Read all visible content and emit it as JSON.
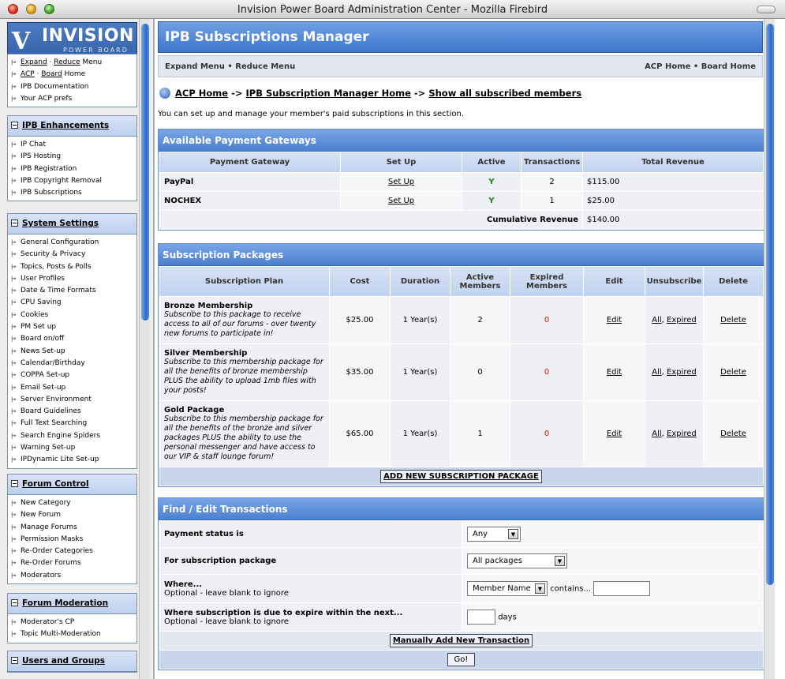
{
  "window": {
    "title": "Invision Power Board Administration Center - Mozilla Firebird"
  },
  "logo": {
    "word": "INVISION",
    "sub": "POWER BOARD"
  },
  "top_links": {
    "expand": "Expand",
    "reduce": "Reduce",
    "menu": "Menu",
    "acp": "ACP",
    "board": "Board",
    "home": "Home",
    "doc": "IPB Documentation",
    "prefs": "Your ACP prefs"
  },
  "sidebar": [
    {
      "title": "IPB Enhancements",
      "items": [
        "IP Chat",
        "IPS Hosting",
        "IPB Registration",
        "IPB Copyright Removal",
        "IPB Subscriptions"
      ]
    },
    {
      "title": "System Settings",
      "items": [
        "General Configuration",
        "Security & Privacy",
        "Topics, Posts & Polls",
        "User Profiles",
        "Date & Time Formats",
        "CPU Saving",
        "Cookies",
        "PM Set up",
        "Board on/off",
        "News Set-up",
        "Calendar/Birthday",
        "COPPA Set-up",
        "Email Set-up",
        "Server Environment",
        "Board Guidelines",
        "Full Text Searching",
        "Search Engine Spiders",
        "Warning Set-up",
        "IPDynamic Lite Set-up"
      ]
    },
    {
      "title": "Forum Control",
      "items": [
        "New Category",
        "New Forum",
        "Manage Forums",
        "Permission Masks",
        "Re-Order Categories",
        "Re-Order Forums",
        "Moderators"
      ]
    },
    {
      "title": "Forum Moderation",
      "items": [
        "Moderator's CP",
        "Topic Multi-Moderation"
      ]
    },
    {
      "title": "Users and Groups",
      "items": []
    }
  ],
  "main": {
    "banner": "IPB Subscriptions Manager",
    "menu_left": "Expand Menu • Reduce Menu",
    "menu_right": "ACP Home • Board Home",
    "crumb1": "ACP Home",
    "sep1": " -> ",
    "crumb2": "IPB Subscription Manager Home",
    "sep2": " -> ",
    "crumb3": "Show all subscribed members",
    "intro": "You can set up and manage your member's paid subscriptions in this section."
  },
  "gateways": {
    "title": "Available Payment Gateways",
    "headers": [
      "Payment Gateway",
      "Set Up",
      "Active",
      "Transactions",
      "Total Revenue"
    ],
    "rows": [
      {
        "name": "PayPal",
        "setup": "Set Up",
        "active": "Y",
        "transactions": "2",
        "revenue": "$115.00"
      },
      {
        "name": "NOCHEX",
        "setup": "Set Up",
        "active": "Y",
        "transactions": "1",
        "revenue": "$25.00"
      }
    ],
    "cum_label": "Cumulative Revenue",
    "cum_value": "$140.00"
  },
  "packages": {
    "title": "Subscription Packages",
    "headers": [
      "Subscription Plan",
      "Cost",
      "Duration",
      "Active Members",
      "Expired Members",
      "Edit",
      "Unsubscribe",
      "Delete"
    ],
    "rows": [
      {
        "name": "Bronze Membership",
        "desc": "Subscribe to this package to receive access to all of our forums - over twenty new forums to participate in!",
        "cost": "$25.00",
        "duration": "1 Year(s)",
        "active": "2",
        "expired": "0",
        "edit": "Edit",
        "all": "All",
        "expired_link": "Expired",
        "delete": "Delete"
      },
      {
        "name": "Silver Membership",
        "desc": "Subscribe to this membership package for all the benefits of bronze membership PLUS the ability to upload 1mb files with your posts!",
        "cost": "$35.00",
        "duration": "1 Year(s)",
        "active": "0",
        "expired": "0",
        "edit": "Edit",
        "all": "All",
        "expired_link": "Expired",
        "delete": "Delete"
      },
      {
        "name": "Gold Package",
        "desc": "Subscribe to this membership package for all the benefits of the bronze and silver packages PLUS the ability to use the personal messenger and have access to our VIP & staff lounge forum!",
        "cost": "$65.00",
        "duration": "1 Year(s)",
        "active": "1",
        "expired": "0",
        "edit": "Edit",
        "all": "All",
        "expired_link": "Expired",
        "delete": "Delete"
      }
    ],
    "add_button": "ADD NEW SUBSCRIPTION PACKAGE"
  },
  "find": {
    "title": "Find / Edit Transactions",
    "status_label": "Payment status is",
    "status_value": "Any",
    "package_label": "For subscription package",
    "package_value": "All packages",
    "where_label": "Where...",
    "where_hint": "Optional - leave blank to ignore",
    "where_field": "Member Name",
    "contains": "contains...",
    "expire_label": "Where subscription is due to expire within the next...",
    "expire_hint": "Optional - leave blank to ignore",
    "days": "days",
    "manual_button": "Manually Add New Transaction",
    "go_button": "Go!"
  },
  "scroll": {
    "left_fraction_shown": 0.45,
    "right_fraction_shown": 0.85
  }
}
